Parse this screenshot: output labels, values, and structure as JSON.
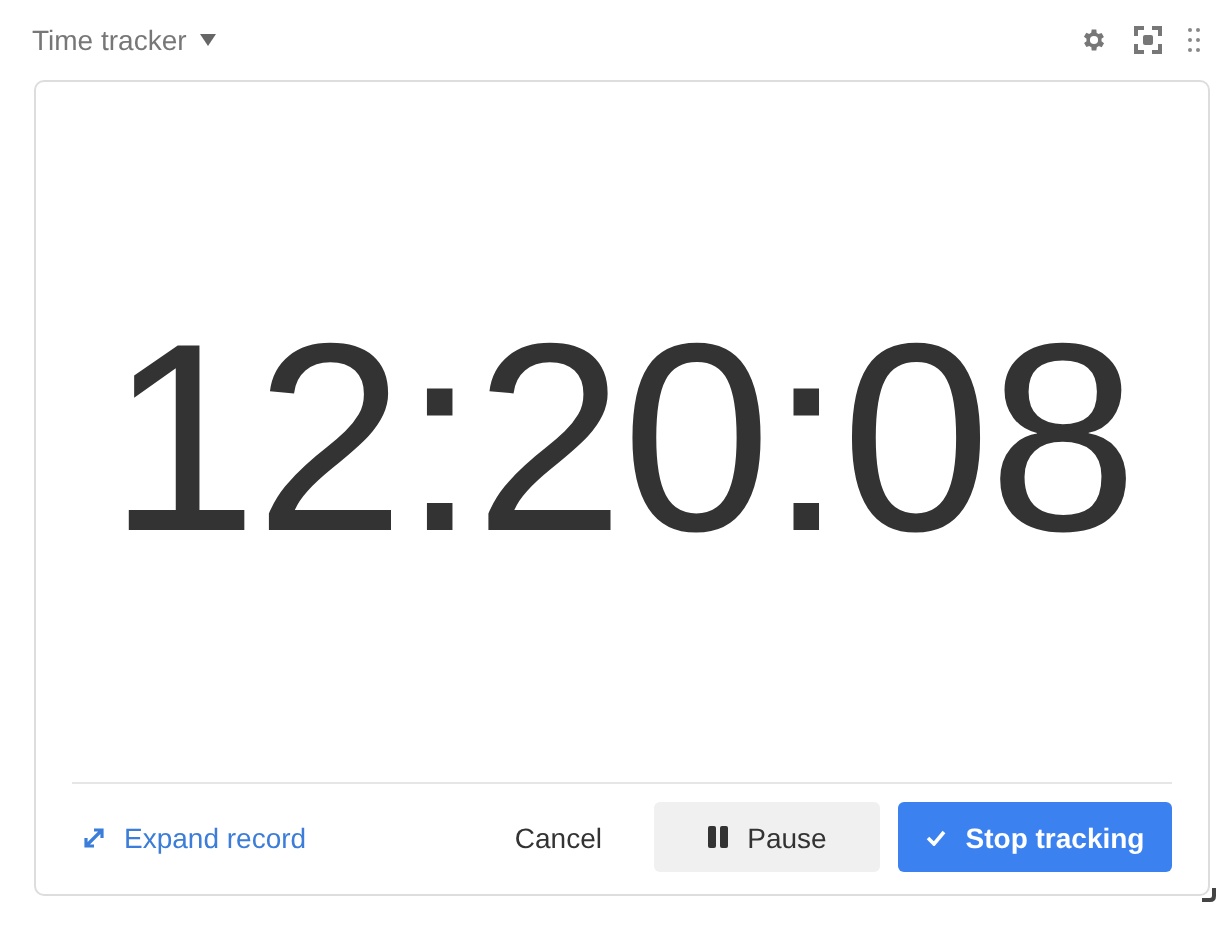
{
  "header": {
    "title": "Time tracker"
  },
  "timer": {
    "time": "12:20:08"
  },
  "footer": {
    "expand_link": "Expand record",
    "cancel": "Cancel",
    "pause": "Pause",
    "stop": "Stop tracking"
  }
}
